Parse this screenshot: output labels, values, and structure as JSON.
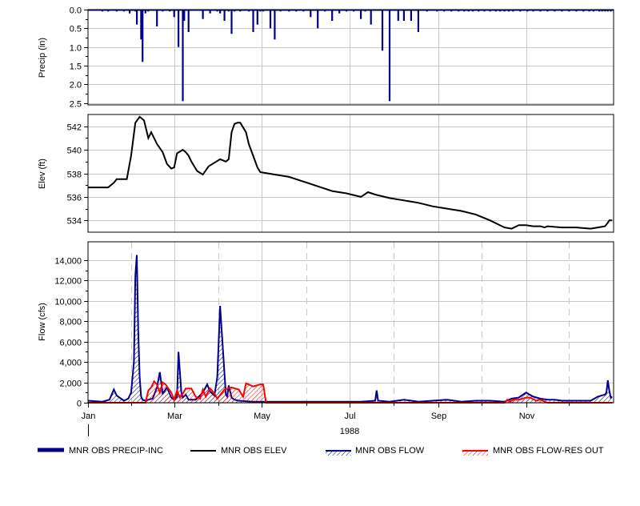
{
  "chart_data": [
    {
      "type": "bar",
      "panel": "precip",
      "ylabel": "Precip (in)",
      "y_ticks": [
        "0.0",
        "0.5",
        "1.0",
        "1.5",
        "2.0",
        "2.5"
      ],
      "y_tick_values": [
        0,
        0.5,
        1.0,
        1.5,
        2.0,
        2.5
      ],
      "ylim": [
        0,
        2.55
      ],
      "y_inverted": true,
      "grid": true,
      "series": [
        {
          "name": "MNR OBS PRECIP-INC",
          "color": "#00008b",
          "x": [
            3,
            10,
            14,
            20,
            25,
            29,
            32,
            33,
            34,
            37,
            38,
            40,
            42,
            48,
            52,
            57,
            60,
            63,
            66,
            67,
            70,
            75,
            80,
            85,
            90,
            92,
            95,
            98,
            100,
            102,
            106,
            112,
            115,
            118,
            120,
            122,
            127,
            130,
            134,
            140,
            145,
            150,
            155,
            160,
            165,
            170,
            175,
            180,
            185,
            190,
            193,
            197,
            205,
            210,
            216,
            220,
            225,
            230,
            236,
            243,
            248,
            253,
            258,
            262,
            265,
            268,
            272,
            276,
            280,
            284,
            287,
            290,
            293,
            296,
            301,
            306,
            310,
            315,
            320,
            325,
            330,
            335,
            340,
            345,
            349,
            352,
            356,
            358,
            360,
            362,
            364
          ],
          "values": [
            0.02,
            0.05,
            0.05,
            0.05,
            0.05,
            0.1,
            0.02,
            0.05,
            0.4,
            0.8,
            1.4,
            0.1,
            0.05,
            0.45,
            0.05,
            0.05,
            0.2,
            1.0,
            2.45,
            0.3,
            0.6,
            0.02,
            0.25,
            0.1,
            0.05,
            0.1,
            0.3,
            0.05,
            0.65,
            0.05,
            0.05,
            0.05,
            0.6,
            0.4,
            0.05,
            0.05,
            0.5,
            0.8,
            0.05,
            0.05,
            0.05,
            0.05,
            0.2,
            0.5,
            0.05,
            0.3,
            0.1,
            0.05,
            0.05,
            0.25,
            0.05,
            0.4,
            1.1,
            2.45,
            0.3,
            0.3,
            0.3,
            0.6,
            0.05,
            0.05,
            0.05,
            0.05,
            0.05,
            0.05,
            0.05,
            0.05,
            0.05,
            0.05,
            0.05,
            0.05,
            0.05,
            0.05,
            0.05,
            0.05,
            0.05,
            0.05,
            0.05,
            0.05,
            0.05,
            0.05,
            0.05,
            0.05,
            0.05,
            0.05,
            0.05,
            0.05,
            0.05,
            0.05,
            0.05,
            0.05,
            0.05
          ]
        }
      ]
    },
    {
      "type": "line",
      "panel": "elev",
      "ylabel": "Elev (ft)",
      "y_ticks": [
        "534",
        "536",
        "538",
        "540",
        "542"
      ],
      "y_tick_values": [
        534,
        536,
        538,
        540,
        542
      ],
      "ylim": [
        533,
        543
      ],
      "grid": true,
      "series": [
        {
          "name": "MNR OBS ELEV",
          "color": "#000000",
          "x": [
            0,
            14,
            18,
            20,
            27,
            30,
            33,
            36,
            39,
            42,
            44,
            48,
            52,
            55,
            58,
            60,
            62,
            66,
            68,
            70,
            72,
            76,
            80,
            84,
            88,
            92,
            96,
            98,
            100,
            102,
            104,
            106,
            110,
            112,
            115,
            118,
            120,
            125,
            130,
            140,
            150,
            160,
            170,
            180,
            190,
            195,
            200,
            210,
            220,
            230,
            240,
            250,
            260,
            270,
            280,
            290,
            295,
            300,
            305,
            310,
            315,
            318,
            320,
            330,
            340,
            350,
            355,
            360,
            362,
            363,
            365
          ],
          "values": [
            536.8,
            536.8,
            537.2,
            537.5,
            537.5,
            539.5,
            542.3,
            542.8,
            542.5,
            541.0,
            541.5,
            540.5,
            539.8,
            538.8,
            538.4,
            538.5,
            539.7,
            540.0,
            539.8,
            539.5,
            539.0,
            538.2,
            537.9,
            538.6,
            538.9,
            539.2,
            539.0,
            539.2,
            541.5,
            542.2,
            542.3,
            542.3,
            541.5,
            540.5,
            539.5,
            538.5,
            538.1,
            538.0,
            537.9,
            537.7,
            537.3,
            536.9,
            536.5,
            536.3,
            536.0,
            536.4,
            536.2,
            535.9,
            535.7,
            535.5,
            535.2,
            535.0,
            534.8,
            534.5,
            534.0,
            533.4,
            533.3,
            533.6,
            533.6,
            533.5,
            533.5,
            533.4,
            533.5,
            533.4,
            533.4,
            533.3,
            533.4,
            533.5,
            533.8,
            534.0,
            534.0
          ]
        }
      ]
    },
    {
      "type": "area",
      "panel": "flow",
      "ylabel": "Flow (cfs)",
      "xlabel": "1988",
      "y_ticks": [
        "0",
        "2,000",
        "4,000",
        "6,000",
        "8,000",
        "10,000",
        "12,000",
        "14,000"
      ],
      "y_tick_values": [
        0,
        2000,
        4000,
        6000,
        8000,
        10000,
        12000,
        14000
      ],
      "ylim": [
        0,
        15800
      ],
      "xlim": [
        0,
        366
      ],
      "x_tick_labels": [
        "Jan",
        "Mar",
        "May",
        "Jul",
        "Sep",
        "Nov"
      ],
      "x_tick_values": [
        0,
        60,
        121,
        182,
        244,
        305
      ],
      "x_grid_values": [
        30,
        91,
        152,
        213,
        274,
        335
      ],
      "grid": true,
      "series": [
        {
          "name": "MNR OBS FLOW",
          "color": "#00008b",
          "x": [
            0,
            10,
            15,
            18,
            20,
            25,
            28,
            30,
            32,
            33,
            34,
            35,
            36,
            37,
            38,
            40,
            42,
            45,
            48,
            50,
            52,
            55,
            58,
            60,
            62,
            63,
            64,
            65,
            66,
            68,
            70,
            75,
            80,
            83,
            85,
            88,
            90,
            92,
            95,
            96,
            97,
            98,
            100,
            102,
            105,
            110,
            115,
            120,
            125,
            130,
            140,
            150,
            160,
            170,
            180,
            190,
            200,
            201,
            202,
            210,
            220,
            230,
            240,
            250,
            260,
            270,
            280,
            290,
            295,
            300,
            305,
            310,
            315,
            320,
            325,
            330,
            340,
            350,
            355,
            360,
            361,
            362,
            363,
            364,
            365
          ],
          "values": [
            200,
            100,
            300,
            1300,
            700,
            200,
            400,
            1000,
            4000,
            12500,
            14500,
            7000,
            2500,
            600,
            300,
            200,
            300,
            400,
            1500,
            3000,
            900,
            1500,
            500,
            300,
            600,
            5000,
            3000,
            1000,
            500,
            800,
            300,
            300,
            1000,
            1800,
            1100,
            700,
            2500,
            9500,
            3000,
            800,
            600,
            1700,
            500,
            300,
            200,
            150,
            100,
            100,
            100,
            100,
            100,
            100,
            100,
            100,
            100,
            100,
            200,
            1200,
            200,
            100,
            300,
            100,
            200,
            300,
            100,
            200,
            200,
            100,
            400,
            500,
            1000,
            600,
            400,
            300,
            300,
            200,
            200,
            200,
            600,
            800,
            1000,
            2200,
            1200,
            500,
            600
          ]
        },
        {
          "name": "MNR OBS FLOW-RES OUT",
          "color": "#ff0000",
          "x": [
            0,
            40,
            42,
            44,
            46,
            48,
            50,
            52,
            54,
            58,
            60,
            62,
            64,
            66,
            68,
            72,
            75,
            78,
            80,
            82,
            85,
            88,
            90,
            95,
            100,
            105,
            108,
            110,
            115,
            120,
            122,
            124,
            126,
            200,
            290,
            292,
            294,
            296,
            300,
            305,
            308,
            312,
            315,
            320,
            340,
            365
          ],
          "values": [
            0,
            0,
            1200,
            1500,
            2100,
            1800,
            1000,
            2000,
            1800,
            1000,
            300,
            1200,
            500,
            900,
            1400,
            1400,
            600,
            400,
            1300,
            600,
            1400,
            900,
            400,
            1300,
            1500,
            1300,
            600,
            1900,
            1600,
            1800,
            1800,
            0,
            0,
            0,
            0,
            300,
            100,
            300,
            300,
            500,
            500,
            200,
            300,
            0,
            0,
            0
          ]
        }
      ]
    }
  ]
}
